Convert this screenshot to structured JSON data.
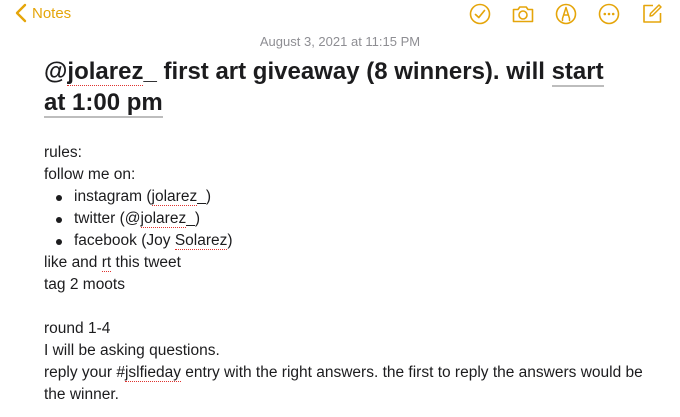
{
  "nav": {
    "back_label": "Notes"
  },
  "toolbar": {
    "icons": [
      "checklist-icon",
      "camera-icon",
      "markup-pen-icon",
      "more-icon",
      "compose-icon"
    ]
  },
  "note": {
    "timestamp": "August 3, 2021 at 11:15 PM",
    "title": {
      "p1": "@",
      "p2": "jolarez",
      "p3": "_ first art giveaway (8 winners). will ",
      "p4": "start",
      "p5": " ",
      "p6": "at 1:00 pm"
    },
    "lines": {
      "rules": "rules:",
      "follow": "follow me on:",
      "ig_a": "instagram (",
      "ig_b": "jolarez",
      "ig_c": "_)",
      "tw_a": "twitter (@",
      "tw_b": "jolarez",
      "tw_c": "_)",
      "fb_a": "facebook (Joy ",
      "fb_b": "Solarez",
      "fb_c": ")",
      "like_a": "like and ",
      "like_b": "rt",
      "like_c": " this tweet",
      "tag": "tag 2 moots",
      "round": "round 1-4",
      "ask": "I will be asking questions.",
      "reply_a": "reply your #",
      "reply_b": "jslfieday",
      "reply_c": " entry with the right answers. the first to reply the answers would be the winner."
    }
  },
  "colors": {
    "accent": "#e5a50a",
    "spellcheck": "#e0332f",
    "timestamp": "#8e8e93"
  }
}
